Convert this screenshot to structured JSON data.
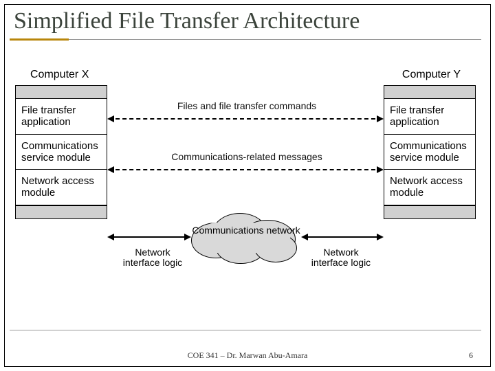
{
  "title": "Simplified File Transfer Architecture",
  "footer": "COE 341 – Dr. Marwan Abu-Amara",
  "page_number": "6",
  "hosts": {
    "left": "Computer X",
    "right": "Computer Y"
  },
  "layers": {
    "file_transfer": "File transfer application",
    "comm_service": "Communications service module",
    "net_access": "Network access module"
  },
  "messages": {
    "top": "Files and file transfer commands",
    "mid": "Communications-related messages"
  },
  "network": {
    "cloud_label": "Communications network",
    "interface_left": "Network interface logic",
    "interface_right": "Network interface logic"
  }
}
